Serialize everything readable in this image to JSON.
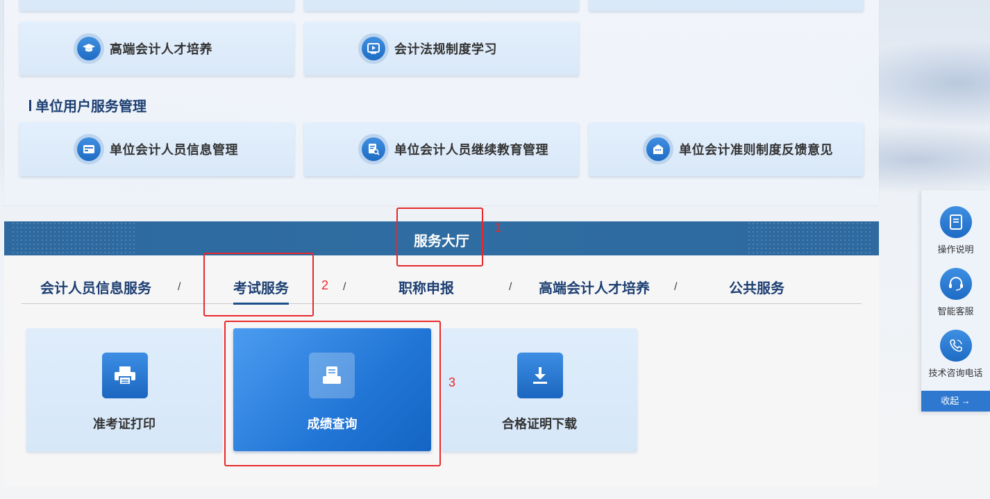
{
  "top_cards": {
    "high_end_training": "高端会计人才培养",
    "law_study": "会计法规制度学习"
  },
  "unit_section": {
    "title": "单位用户服务管理",
    "items": [
      {
        "label": "单位会计人员信息管理",
        "icon": "id-card-icon"
      },
      {
        "label": "单位会计人员继续教育管理",
        "icon": "document-search-icon"
      },
      {
        "label": "单位会计准则制度反馈意见",
        "icon": "building-icon"
      }
    ]
  },
  "service_hall": {
    "title": "服务大厅",
    "tabs": [
      "会计人员信息服务",
      "考试服务",
      "职称申报",
      "高端会计人才培养",
      "公共服务"
    ],
    "separator": "/",
    "active_tab": "考试服务",
    "services": [
      {
        "label": "准考证打印",
        "icon": "printer-icon"
      },
      {
        "label": "成绩查询",
        "icon": "score-query-icon"
      },
      {
        "label": "合格证明下载",
        "icon": "download-icon"
      }
    ],
    "active_service": "成绩查询"
  },
  "annotations": [
    "1",
    "2",
    "3"
  ],
  "side_panel": {
    "items": [
      {
        "label": "操作说明",
        "icon": "manual-icon"
      },
      {
        "label": "智能客服",
        "icon": "headset-icon"
      },
      {
        "label": "技术咨询电话",
        "icon": "phone-icon"
      }
    ],
    "collapse_label": "收起 →"
  },
  "colors": {
    "accent": "#2f78cf",
    "header_bar": "#2e6a9f",
    "annotation": "#e8282b",
    "title_text": "#1d3f72"
  }
}
